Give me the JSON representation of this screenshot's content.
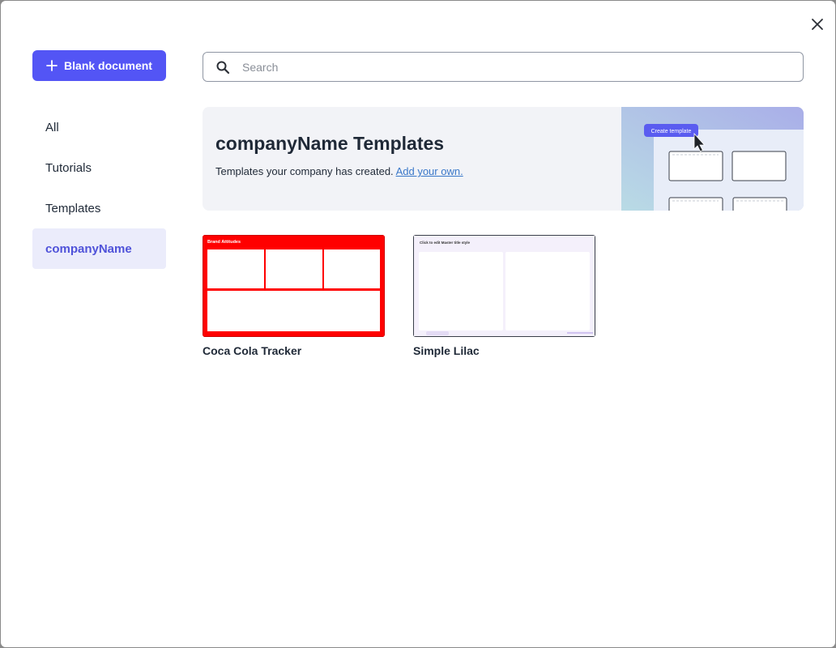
{
  "dialog": {
    "close_icon": "close-icon"
  },
  "sidebar": {
    "blank_button_label": "Blank document",
    "items": [
      {
        "label": "All",
        "active": false
      },
      {
        "label": "Tutorials",
        "active": false
      },
      {
        "label": "Templates",
        "active": false
      },
      {
        "label": "companyName",
        "active": true
      }
    ]
  },
  "search": {
    "placeholder": "Search",
    "value": ""
  },
  "banner": {
    "title": "companyName Templates",
    "subtitle": "Templates your company has created.",
    "link": "Add your own.",
    "illustration_button": "Create template"
  },
  "templates": [
    {
      "name": "Coca Cola Tracker",
      "thumb_title": "Brand Attitudes",
      "accent": "#ff0000"
    },
    {
      "name": "Simple Lilac",
      "thumb_title": "Click to edit Master title style",
      "accent": "#b9a6e8"
    }
  ],
  "colors": {
    "primary": "#5355f5",
    "active_bg": "#ebecfb",
    "link": "#3a78c9"
  }
}
